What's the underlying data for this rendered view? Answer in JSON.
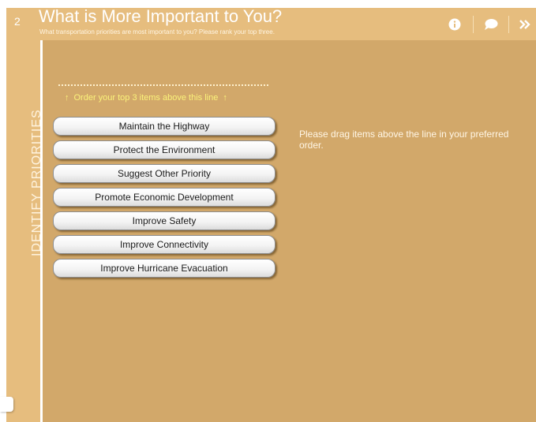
{
  "header": {
    "step_number": "2",
    "title": "What is More Important to You?",
    "subtitle": "What transportation priorities are most important to you? Please rank your top three.",
    "icons": [
      "info-icon",
      "comment-icon",
      "double-chevron-right-icon"
    ]
  },
  "sidebar": {
    "label": "IDENTIFY PRIORITIES"
  },
  "main": {
    "order_hint": "Order your top 3 items above this line",
    "instruction": "Please drag items above the line in your preferred order.",
    "items": [
      {
        "label": "Maintain the Highway"
      },
      {
        "label": "Protect the Environment"
      },
      {
        "label": "Suggest Other Priority"
      },
      {
        "label": "Promote Economic Development"
      },
      {
        "label": "Improve Safety"
      },
      {
        "label": "Improve Connectivity"
      },
      {
        "label": "Improve Hurricane Evacuation"
      }
    ]
  },
  "colors": {
    "header_bg": "#e6bd7e",
    "panel_bg": "#d2a86a",
    "hint_text": "#fbf27a"
  }
}
